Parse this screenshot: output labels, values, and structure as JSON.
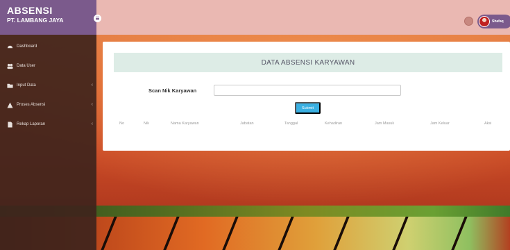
{
  "brand": {
    "title": "ABSENSI",
    "subtitle": "PT. LAMBANG JAYA"
  },
  "sidebar": {
    "items": [
      {
        "label": "Dashboard",
        "icon": "dashboard-icon",
        "has_submenu": false
      },
      {
        "label": "Data User",
        "icon": "users-icon",
        "has_submenu": false
      },
      {
        "label": "Input Data",
        "icon": "folder-icon",
        "has_submenu": true
      },
      {
        "label": "Proses Absensi",
        "icon": "user-icon",
        "has_submenu": true
      },
      {
        "label": "Rekap Laporan",
        "icon": "file-icon",
        "has_submenu": true
      }
    ]
  },
  "topbar": {
    "user_name": "Shafaq"
  },
  "main": {
    "title": "DATA ABSENSI KARYAWAN",
    "form": {
      "label": "Scan Nik Karyawan",
      "value": "",
      "submit_label": "Submit"
    },
    "table": {
      "columns": [
        "No",
        "Nik",
        "Nama Karyawan",
        "Jabatan",
        "Tanggal",
        "Kehadiran",
        "Jam Masuk",
        "Jam Keluar",
        "Aksi"
      ]
    }
  },
  "colors": {
    "brand": "#7b5a8c",
    "sidebar": "#3f241c",
    "topbar": "#eab8b2",
    "panel_header": "#ddece6",
    "submit": "#3ab0e2"
  }
}
